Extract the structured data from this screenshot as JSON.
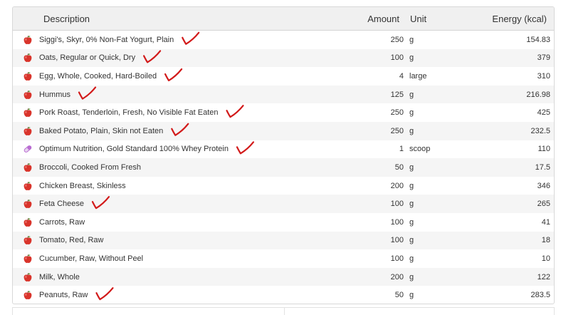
{
  "header": {
    "description": "Description",
    "amount": "Amount",
    "unit": "Unit",
    "energy": "Energy (kcal)"
  },
  "rows": [
    {
      "description": "Siggi's, Skyr, 0% Non-Fat Yogurt, Plain",
      "amount": "250",
      "unit": "g",
      "energy": "154.83",
      "icon": "apple-icon",
      "checked": true
    },
    {
      "description": "Oats, Regular or Quick, Dry",
      "amount": "100",
      "unit": "g",
      "energy": "379",
      "icon": "apple-icon",
      "checked": true
    },
    {
      "description": "Egg, Whole, Cooked, Hard-Boiled",
      "amount": "4",
      "unit": "large",
      "energy": "310",
      "icon": "apple-icon",
      "checked": true
    },
    {
      "description": "Hummus",
      "amount": "125",
      "unit": "g",
      "energy": "216.98",
      "icon": "apple-icon",
      "checked": true
    },
    {
      "description": "Pork Roast, Tenderloin, Fresh, No Visible Fat Eaten",
      "amount": "250",
      "unit": "g",
      "energy": "425",
      "icon": "apple-icon",
      "checked": true
    },
    {
      "description": "Baked Potato, Plain, Skin not Eaten",
      "amount": "250",
      "unit": "g",
      "energy": "232.5",
      "icon": "apple-icon",
      "checked": true
    },
    {
      "description": "Optimum Nutrition, Gold Standard 100% Whey Protein",
      "amount": "1",
      "unit": "scoop",
      "energy": "110",
      "icon": "pill-icon",
      "checked": true
    },
    {
      "description": "Broccoli, Cooked From Fresh",
      "amount": "50",
      "unit": "g",
      "energy": "17.5",
      "icon": "apple-icon",
      "checked": false
    },
    {
      "description": "Chicken Breast, Skinless",
      "amount": "200",
      "unit": "g",
      "energy": "346",
      "icon": "apple-icon",
      "checked": false
    },
    {
      "description": "Feta Cheese",
      "amount": "100",
      "unit": "g",
      "energy": "265",
      "icon": "apple-icon",
      "checked": true
    },
    {
      "description": "Carrots, Raw",
      "amount": "100",
      "unit": "g",
      "energy": "41",
      "icon": "apple-icon",
      "checked": false
    },
    {
      "description": "Tomato, Red, Raw",
      "amount": "100",
      "unit": "g",
      "energy": "18",
      "icon": "apple-icon",
      "checked": false
    },
    {
      "description": "Cucumber, Raw, Without Peel",
      "amount": "100",
      "unit": "g",
      "energy": "10",
      "icon": "apple-icon",
      "checked": false
    },
    {
      "description": "Milk, Whole",
      "amount": "200",
      "unit": "g",
      "energy": "122",
      "icon": "apple-icon",
      "checked": false
    },
    {
      "description": "Peanuts, Raw",
      "amount": "50",
      "unit": "g",
      "energy": "283.5",
      "icon": "apple-icon",
      "checked": true
    }
  ],
  "colors": {
    "apple": "#d9342b",
    "pill": "#b86bd1",
    "checkmark": "#d21a1a"
  }
}
